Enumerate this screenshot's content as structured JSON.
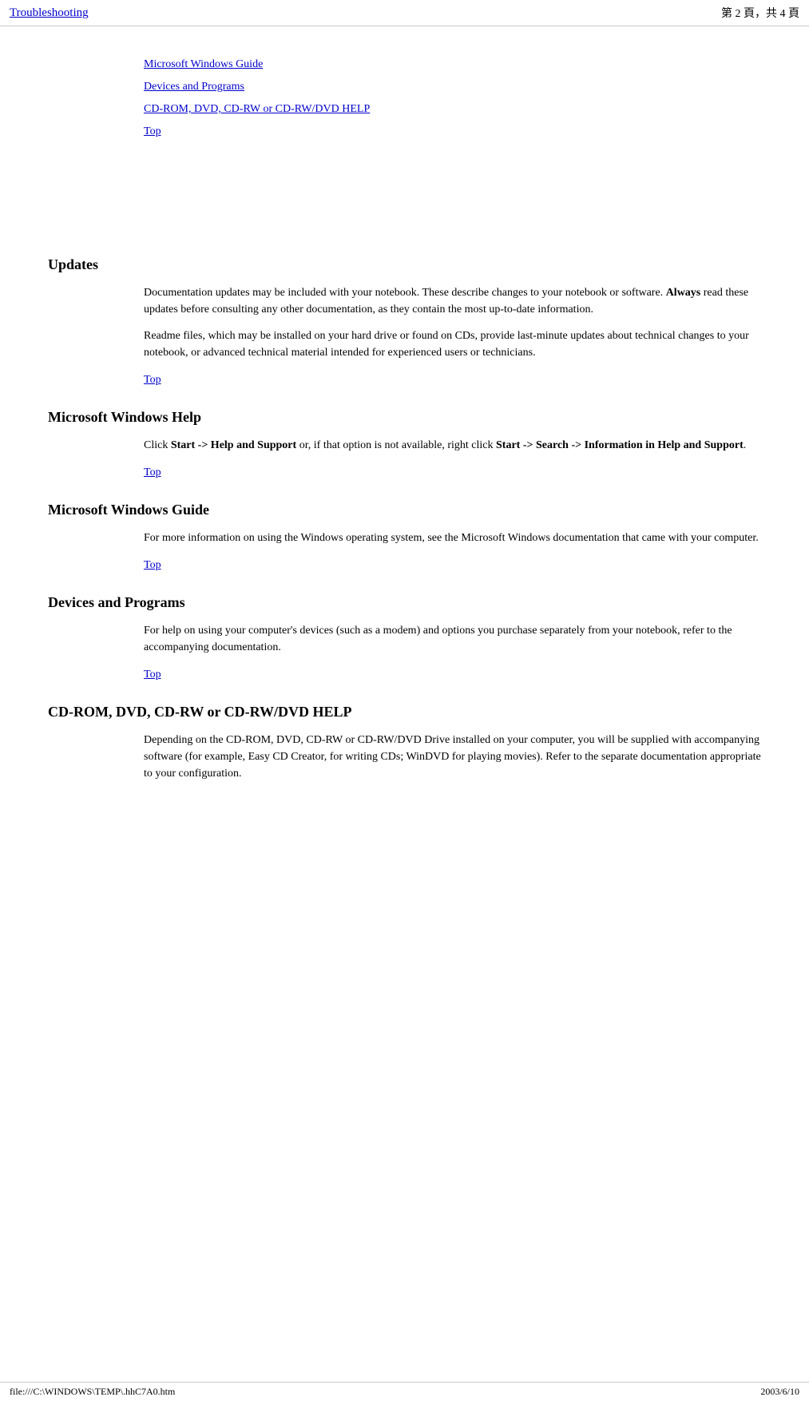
{
  "header": {
    "title": "Troubleshooting",
    "page_info": "第 2 頁，共 4 頁"
  },
  "toc": {
    "link1": "Microsoft Windows Guide",
    "link2": "Devices and Programs",
    "link3": "CD-ROM, DVD, CD-RW or CD-RW/DVD HELP",
    "link4": "Top"
  },
  "sections": [
    {
      "id": "updates",
      "heading": "Updates",
      "paragraphs": [
        "Documentation updates may be included with your notebook. These describe changes to your notebook or software. Always read these updates before consulting any other documentation, as they contain the most up-to-date information.",
        "Readme files, which may be installed on your hard drive or found on CDs, provide last-minute updates about technical changes to your notebook, or advanced technical material intended for experienced users or technicians."
      ],
      "top_label": "Top",
      "bold_in_first": "Always"
    },
    {
      "id": "microsoft-windows-help",
      "heading": "Microsoft Windows Help",
      "paragraphs": [
        "Click Start -> Help and Support or, if that option is not available, right click Start -> Search -> Information in Help and Support."
      ],
      "top_label": "Top"
    },
    {
      "id": "microsoft-windows-guide",
      "heading": "Microsoft Windows Guide",
      "paragraphs": [
        "For more information on using the Windows operating system, see the Microsoft Windows documentation that came with your computer."
      ],
      "top_label": "Top"
    },
    {
      "id": "devices-and-programs",
      "heading": "Devices and Programs",
      "paragraphs": [
        "For help on using your computer's devices (such as a modem) and options you purchase separately from your notebook, refer to the accompanying documentation."
      ],
      "top_label": "Top"
    },
    {
      "id": "cdrom-help",
      "heading": "CD-ROM, DVD, CD-RW or CD-RW/DVD HELP",
      "paragraphs": [
        "Depending on the CD-ROM, DVD, CD-RW or CD-RW/DVD Drive installed on your computer, you will be supplied with accompanying software (for example, Easy CD Creator, for writing CDs; WinDVD for playing movies). Refer to the separate documentation appropriate to your configuration."
      ],
      "top_label": ""
    }
  ],
  "footer": {
    "url": "file:///C:\\WINDOWS\\TEMP\\.hhC7A0.htm",
    "date": "2003/6/10"
  },
  "colors": {
    "link": "#0000cc",
    "text": "#000000",
    "background": "#ffffff"
  }
}
